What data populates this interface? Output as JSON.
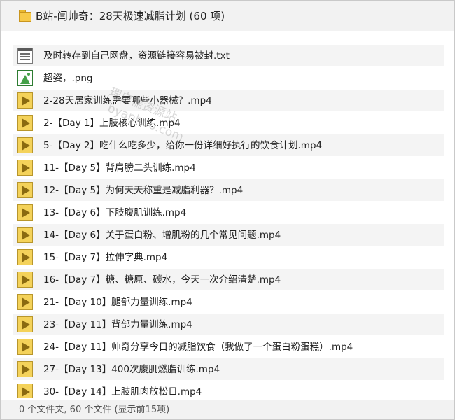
{
  "window": {
    "title": "B站-闫帅奇：28天极速减脂计划 (60 项)"
  },
  "files": [
    {
      "name": "及时转存到自己网盘，资源链接容易被封.txt",
      "icon": "text-file-icon"
    },
    {
      "name": "超姿，.png",
      "icon": "image-file-icon"
    },
    {
      "name": "2-28天居家训练需要哪些小器械？.mp4",
      "icon": "video-file-icon"
    },
    {
      "name": "2-【Day 1】上肢核心训练.mp4",
      "icon": "video-file-icon"
    },
    {
      "name": "5-【Day 2】吃什么吃多少，给你一份详细好执行的饮食计划.mp4",
      "icon": "video-file-icon"
    },
    {
      "name": "11-【Day 5】背肩膀二头训练.mp4",
      "icon": "video-file-icon"
    },
    {
      "name": "12-【Day 5】为何天天称重是减脂利器？.mp4",
      "icon": "video-file-icon"
    },
    {
      "name": "13-【Day 6】下肢腹肌训练.mp4",
      "icon": "video-file-icon"
    },
    {
      "name": "14-【Day 6】关于蛋白粉、增肌粉的几个常见问题.mp4",
      "icon": "video-file-icon"
    },
    {
      "name": "15-【Day 7】拉伸字典.mp4",
      "icon": "video-file-icon"
    },
    {
      "name": "16-【Day 7】糖、糖原、碳水，今天一次介绍清楚.mp4",
      "icon": "video-file-icon"
    },
    {
      "name": "21-【Day 10】腿部力量训练.mp4",
      "icon": "video-file-icon"
    },
    {
      "name": "23-【Day 11】背部力量训练.mp4",
      "icon": "video-file-icon"
    },
    {
      "name": "24-【Day 11】帅奇分享今日的减脂饮食（我做了一个蛋白粉蛋糕）.mp4",
      "icon": "video-file-icon"
    },
    {
      "name": "27-【Day 13】400次腹肌燃脂训练.mp4",
      "icon": "video-file-icon"
    },
    {
      "name": "30-【Day 14】上肢肌肉放松日.mp4",
      "icon": "video-file-icon"
    }
  ],
  "watermark": {
    "line1": "理白懦资源站",
    "line2": "byanhuo.com"
  },
  "status": {
    "text": "0 个文件夹, 60 个文件 (显示前15项)"
  }
}
